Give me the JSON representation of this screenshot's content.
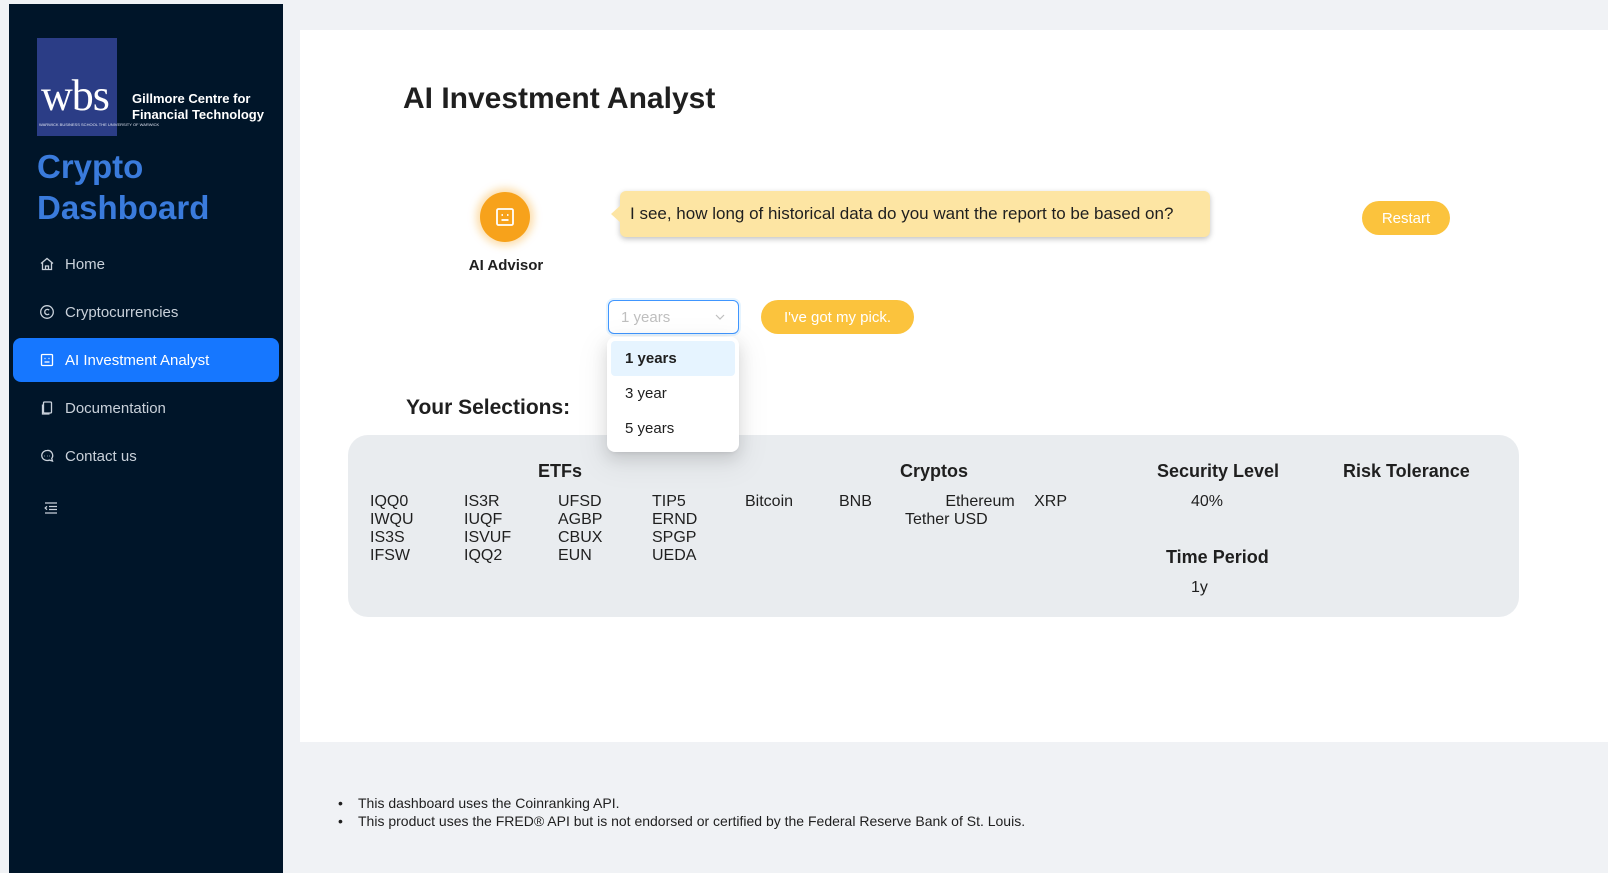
{
  "sidebar": {
    "logo": {
      "wordmark": "wbs",
      "small_text": "WARWICK BUSINESS SCHOOL THE UNIVERSITY OF WARWICK",
      "centre_line1": "Gillmore Centre for",
      "centre_line2": "Financial Technology"
    },
    "brand_line1": "Crypto",
    "brand_line2": "Dashboard",
    "items": [
      {
        "label": "Home",
        "icon": "home-icon"
      },
      {
        "label": "Cryptocurrencies",
        "icon": "copyright-icon"
      },
      {
        "label": "AI Investment Analyst",
        "icon": "robot-icon",
        "active": true
      },
      {
        "label": "Documentation",
        "icon": "document-icon"
      },
      {
        "label": "Contact us",
        "icon": "message-icon"
      }
    ],
    "collapse_icon": "menu-fold-icon"
  },
  "main": {
    "title": "AI Investment Analyst",
    "advisor": {
      "label": "AI Advisor",
      "icon": "robot-icon"
    },
    "message": "I see, how long of historical data do you want the report to be based on?",
    "restart_label": "Restart",
    "select": {
      "placeholder": "1 years",
      "options": [
        "1 years",
        "3 year",
        "5 years"
      ],
      "highlighted": "1 years"
    },
    "pick_label": "I've got my pick.",
    "selections": {
      "title": "Your Selections:",
      "etfs_heading": "ETFs",
      "etfs": [
        "IQQ0",
        "IS3R",
        "UFSD",
        "TIP5",
        "IWQU",
        "IUQF",
        "AGBP",
        "ERND",
        "IS3S",
        "ISVUF",
        "CBUX",
        "SPGP",
        "IFSW",
        "IQQ2",
        "EUN",
        "UEDA"
      ],
      "cryptos_heading": "Cryptos",
      "cryptos": [
        "Bitcoin",
        "BNB",
        "Ethereum",
        "XRP",
        "Tether USD"
      ],
      "security_heading": "Security Level",
      "security_value": "40%",
      "risk_heading": "Risk Tolerance",
      "time_heading": "Time Period",
      "time_value": "1y"
    }
  },
  "footer": {
    "notes": [
      "This dashboard uses the Coinranking API.",
      "This product uses the FRED® API but is not endorsed or certified by the Federal Reserve Bank of St. Louis."
    ]
  },
  "colors": {
    "sidebar_bg": "#001529",
    "accent_blue": "#1677ff",
    "brand_blue": "#3a7bdc",
    "button_yellow": "#fbc33d",
    "bubble_yellow": "#fde5a3",
    "advisor_orange": "#f7a21b"
  }
}
